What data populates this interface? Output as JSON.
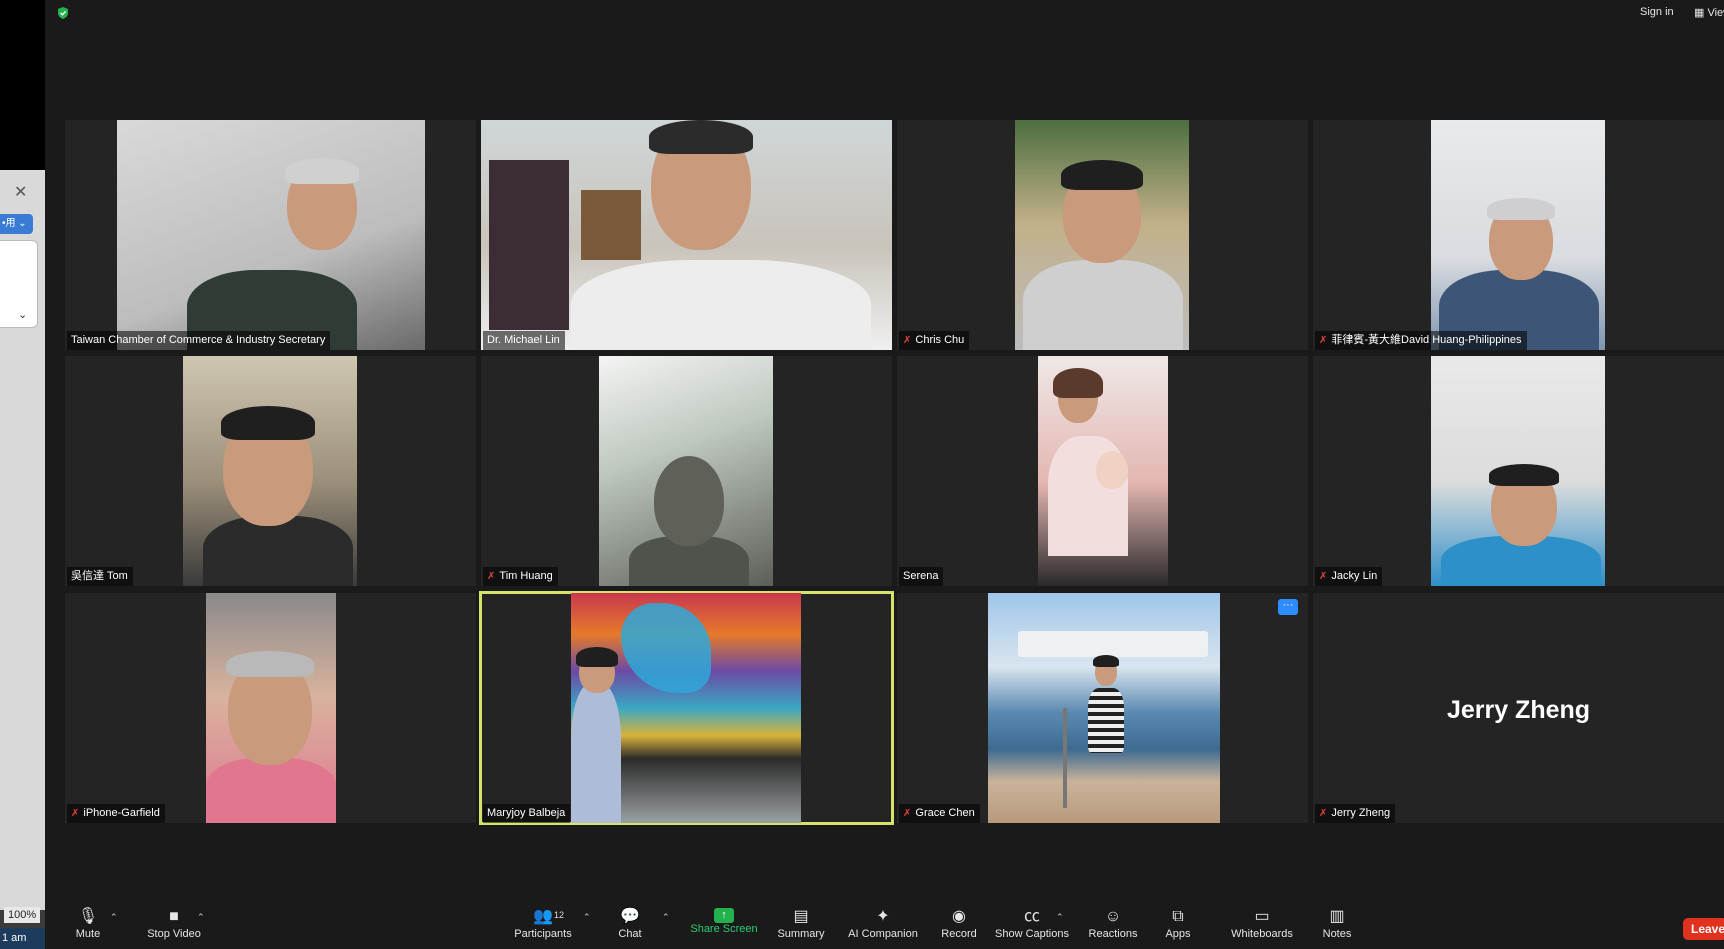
{
  "window": {
    "sign_in": "Sign in",
    "view": "View",
    "left_app": {
      "select_label": "•用",
      "zoom": "100%",
      "time": "1 am"
    }
  },
  "gallery": {
    "tiles": [
      {
        "name": "Taiwan Chamber of Commerce & Industry Secretary",
        "muted": false
      },
      {
        "name": "Dr. Michael Lin",
        "muted": false
      },
      {
        "name": "Chris Chu",
        "muted": true
      },
      {
        "name": "菲律賓-黃大維David Huang-Philippines",
        "muted": true
      },
      {
        "name": "吳信達 Tom",
        "muted": false
      },
      {
        "name": "Tim Huang",
        "muted": true
      },
      {
        "name": "Serena",
        "muted": false
      },
      {
        "name": "Jacky Lin",
        "muted": true
      },
      {
        "name": "iPhone-Garfield",
        "muted": true
      },
      {
        "name": "Maryjoy Balbeja",
        "muted": false,
        "active_speaker": true
      },
      {
        "name": "Grace Chen",
        "muted": true
      },
      {
        "name": "Jerry Zheng",
        "muted": true,
        "video_off": true,
        "display_name": "Jerry Zheng"
      }
    ],
    "more_button": "···"
  },
  "toolbar": {
    "mute": "Mute",
    "stop_video": "Stop Video",
    "participants": "Participants",
    "participants_count": "12",
    "chat": "Chat",
    "share_screen": "Share Screen",
    "summary": "Summary",
    "ai_companion": "AI Companion",
    "record": "Record",
    "show_captions": "Show Captions",
    "reactions": "Reactions",
    "apps": "Apps",
    "whiteboards": "Whiteboards",
    "notes": "Notes",
    "leave": "Leave"
  },
  "colors": {
    "background": "#1a1a1a",
    "tile": "#242424",
    "active_speaker_border": "#d6e36b",
    "muted_icon": "#e0453b",
    "share_green": "#22b14c",
    "leave_red": "#e0321f",
    "accent_blue": "#2d8cff"
  }
}
